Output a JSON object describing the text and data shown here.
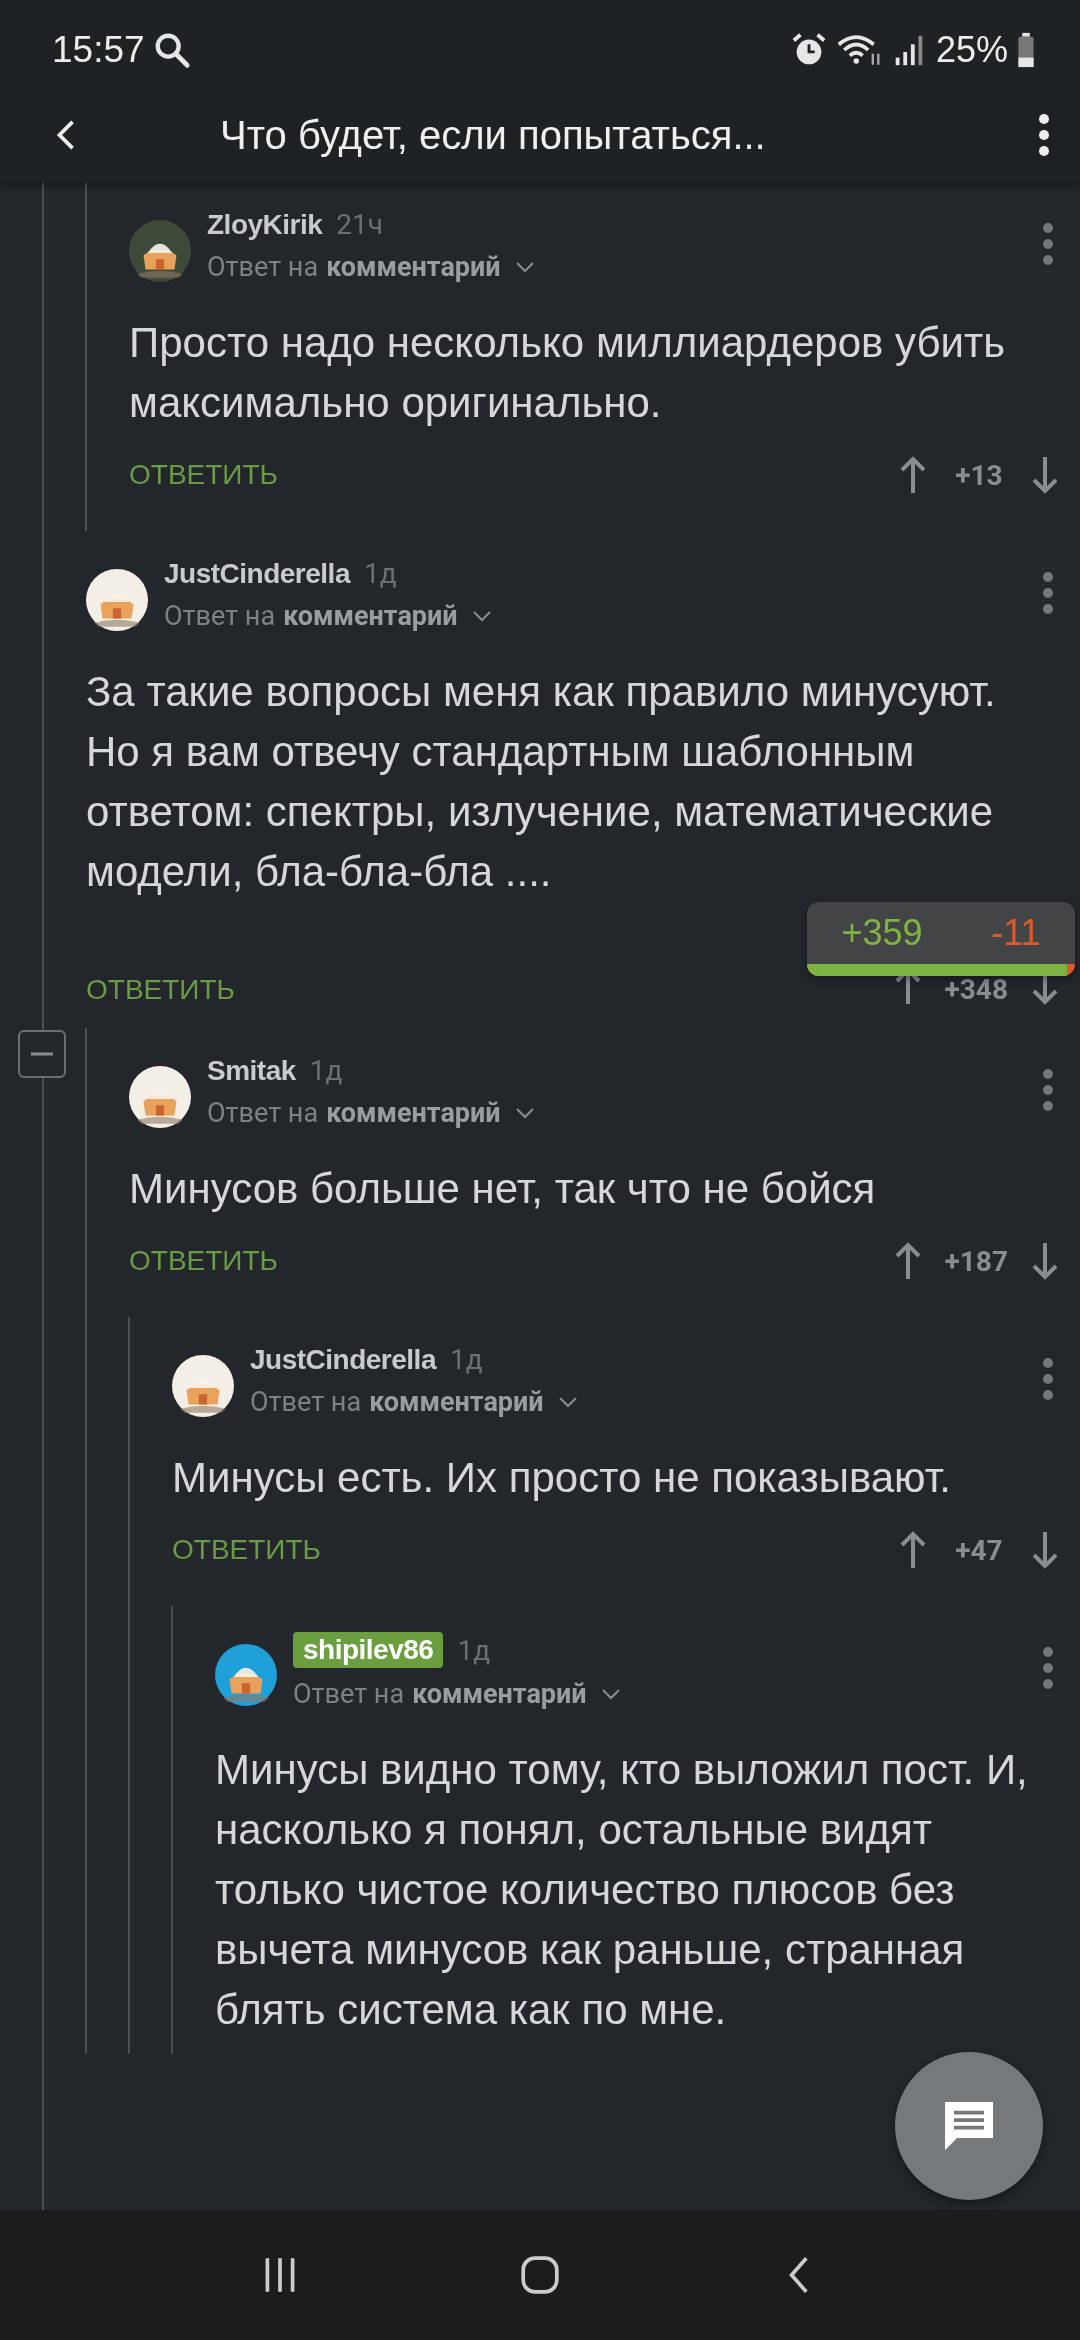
{
  "status_bar": {
    "time": "15:57",
    "battery": "25%"
  },
  "header": {
    "title": "Что будет, если попытаться..."
  },
  "earlier_replies": [
    {
      "author": "ZloyKirik",
      "author_highlighted": false,
      "age": "21ч",
      "reply_prefix": "Ответ на",
      "reply_target": "комментарий",
      "text": "Просто надо несколько миллиардеров убить максимально оригинально.",
      "reply_label": "ОТВЕТИТЬ",
      "score": "+13"
    }
  ],
  "comments": [
    {
      "author": "JustCinderella",
      "author_highlighted": false,
      "age": "1д",
      "reply_prefix": "Ответ на",
      "reply_target": "комментарий",
      "text": "За такие вопросы меня как правило минусуют. Но я вам отвечу стандартным шаблонным ответом: спектры, излучение, математические модели, бла-бла-бла ....",
      "reply_label": "ОТВЕТИТЬ",
      "score": "+348",
      "rating_popup": {
        "plus": "+359",
        "minus": "-11",
        "level": 0.97
      },
      "expanded": true,
      "children": [
        {
          "author": "Smitak",
          "author_highlighted": false,
          "age": "1д",
          "reply_prefix": "Ответ на",
          "reply_target": "комментарий",
          "text": "Минусов больше нет, так что не бойся",
          "reply_label": "ОТВЕТИТЬ",
          "score": "+187",
          "children": [
            {
              "author": "JustCinderella",
              "author_highlighted": false,
              "age": "1д",
              "reply_prefix": "Ответ на",
              "reply_target": "комментарий",
              "text": "Минусы есть. Их просто не показывают.",
              "reply_label": "ОТВЕТИТЬ",
              "score": "+47",
              "children": [
                {
                  "author": "shipilev86",
                  "author_highlighted": true,
                  "age": "1д",
                  "reply_prefix": "Ответ на",
                  "reply_target": "комментарий",
                  "text": "Минусы видно тому, кто выложил пост. И, насколько я понял, остальные видят только чистое количество плюсов без вычета минусов как раньше, странная блять система как по мне."
                }
              ]
            }
          ]
        }
      ]
    }
  ]
}
